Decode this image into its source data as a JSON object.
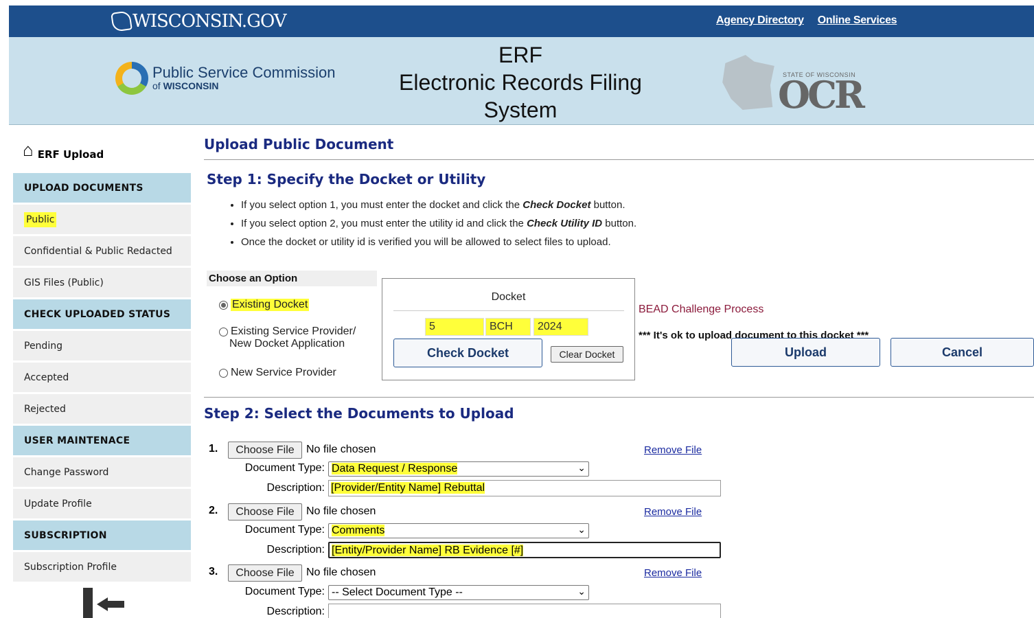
{
  "topbar": {
    "brand": "WISCONSIN.GOV",
    "links": [
      "Agency Directory",
      "Online Services"
    ],
    "color": "#1d4f8c"
  },
  "banner": {
    "psc_line1": "Public Service Commission",
    "psc_line2_prefix": "of",
    "psc_line2_bold": "WISCONSIN",
    "title_lines": [
      "ERF",
      "Electronic Records Filing",
      "System"
    ],
    "ocr_small": "STATE OF WISCONSIN",
    "ocr_big": "OCR"
  },
  "sidebar": {
    "home_label": "ERF Upload",
    "sections": [
      {
        "header": "UPLOAD DOCUMENTS",
        "items": [
          "Public",
          "Confidential & Public Redacted",
          "GIS Files (Public)"
        ]
      },
      {
        "header": "CHECK UPLOADED STATUS",
        "items": [
          "Pending",
          "Accepted",
          "Rejected"
        ]
      },
      {
        "header": "USER MAINTENACE",
        "items": [
          "Change Password",
          "Update Profile"
        ]
      },
      {
        "header": "SUBSCRIPTION",
        "items": [
          "Subscription Profile"
        ]
      }
    ]
  },
  "main": {
    "page_title": "Upload Public Document",
    "step1_title": "Step 1: Specify the Docket or Utility",
    "bullets": [
      {
        "pre": "If you select option 1, you must enter the docket and click the ",
        "em": "Check Docket",
        "post": " button."
      },
      {
        "pre": "If you select option 2, you must enter the utility id and click the ",
        "em": "Check Utility ID",
        "post": " button."
      },
      {
        "pre": "Once the docket or utility id is verified you will be allowed to select files to upload.",
        "em": "",
        "post": ""
      }
    ],
    "choose_option": "Choose an Option",
    "options": [
      "Existing Docket",
      "Existing Service Provider/",
      "New Docket Application",
      "New Service Provider"
    ],
    "docket": {
      "label": "Docket",
      "part1": "5",
      "part2": "BCH",
      "part3": "2024",
      "check_button": "Check Docket",
      "clear_button": "Clear Docket"
    },
    "docket_name": "BEAD Challenge Process",
    "ok_message": "*** It's ok to upload document to this docket ***",
    "upload_button": "Upload",
    "cancel_button": "Cancel",
    "step2_title": "Step 2: Select the Documents to Upload",
    "files": [
      {
        "num": "1.",
        "choose": "Choose File",
        "status": "No file chosen",
        "remove": "Remove File",
        "type_label": "Document Type:",
        "type": "Data Request / Response",
        "desc_label": "Description:",
        "desc": "[Provider/Entity Name] Rebuttal"
      },
      {
        "num": "2.",
        "choose": "Choose File",
        "status": "No file chosen",
        "remove": "Remove File",
        "type_label": "Document Type:",
        "type": "Comments",
        "desc_label": "Description:",
        "desc": "[Entity/Provider Name] RB Evidence [#]"
      },
      {
        "num": "3.",
        "choose": "Choose File",
        "status": "No file chosen",
        "remove": "Remove File",
        "type_label": "Document Type:",
        "type": "-- Select Document Type --",
        "desc_label": "Description:",
        "desc": ""
      }
    ]
  },
  "colors": {
    "heading": "#1a2a80",
    "sidebar_header": "#b8d9e6",
    "highlight": "#ffff3a",
    "docket_name": "#8b1a3b"
  }
}
